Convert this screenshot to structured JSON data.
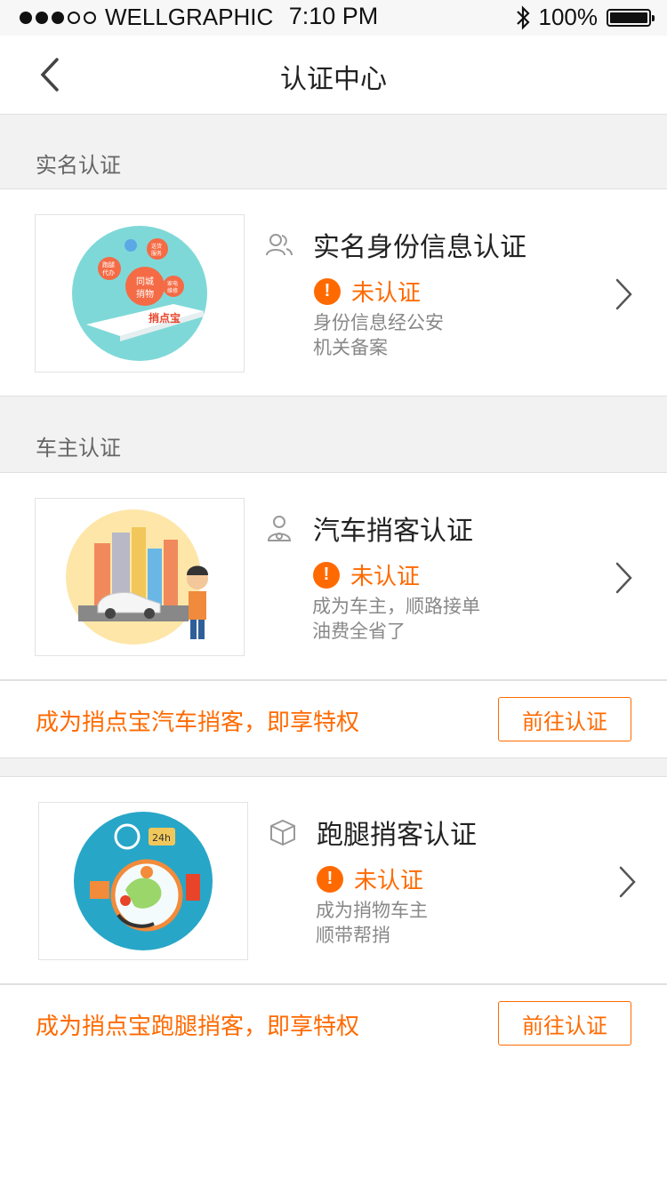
{
  "status_bar": {
    "carrier": "WELLGRAPHIC",
    "time": "7:10 PM",
    "battery": "100%"
  },
  "nav": {
    "title": "认证中心"
  },
  "sections": {
    "real_name": "实名认证",
    "car_owner": "车主认证"
  },
  "cards": {
    "identity": {
      "title": "实名身份信息认证",
      "status": "未认证",
      "desc_line1": "身份信息经公安",
      "desc_line2": "机关备案",
      "thumb_texts": {
        "t1": "同城",
        "t2": "捎物",
        "t3": "跑腿",
        "t4": "代办",
        "t5": "家电",
        "t6": "维修",
        "t7": "送货",
        "t8": "服务",
        "logo": "捎点宝"
      }
    },
    "car": {
      "title": "汽车捎客认证",
      "status": "未认证",
      "desc_line1": "成为车主，顺路接单",
      "desc_line2": "油费全省了"
    },
    "runner": {
      "title": "跑腿捎客认证",
      "status": "未认证",
      "desc_line1": "成为捎物车主",
      "desc_line2": "顺带帮捎",
      "thumb_texts": {
        "badge": "24h"
      }
    }
  },
  "promos": {
    "car": {
      "text": "成为捎点宝汽车捎客，即享特权",
      "button": "前往认证"
    },
    "runner": {
      "text": "成为捎点宝跑腿捎客，即享特权",
      "button": "前往认证"
    }
  },
  "colors": {
    "accent": "#ff6a00",
    "background": "#f2f2f2"
  }
}
